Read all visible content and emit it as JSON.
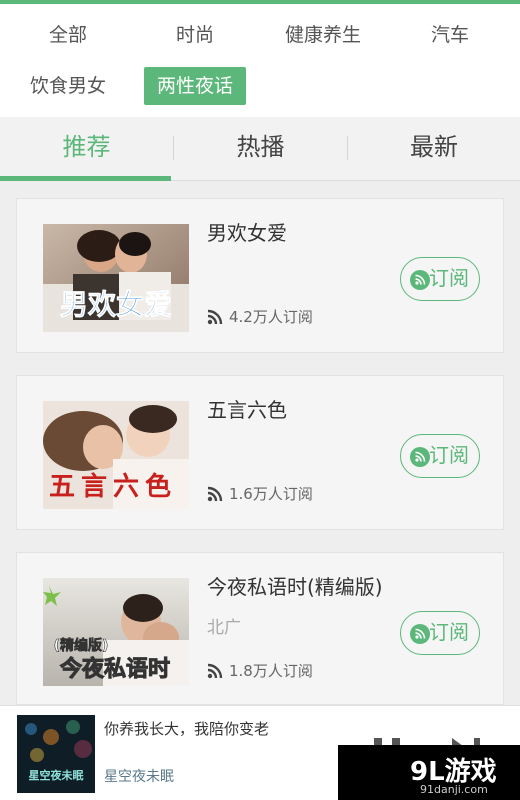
{
  "categories": {
    "items": [
      "全部",
      "时尚",
      "健康养生",
      "汽车",
      "饮食男女",
      "两性夜话"
    ],
    "active_index": 5
  },
  "tabs": {
    "items": [
      "推荐",
      "热播",
      "最新"
    ],
    "active_index": 0
  },
  "programs": [
    {
      "title": "男欢女爱",
      "subtitle": "",
      "subscribers": "4.2万人订阅",
      "subscribe_label": "订阅",
      "cover_text": "男欢女爱"
    },
    {
      "title": "五言六色",
      "subtitle": "",
      "subscribers": "1.6万人订阅",
      "subscribe_label": "订阅",
      "cover_text": "五言六色"
    },
    {
      "title": "今夜私语时(精编版)",
      "subtitle": "北广",
      "subscribers": "1.8万人订阅",
      "subscribe_label": "订阅",
      "cover_text_top": "(精编版)",
      "cover_text": "今夜私语时"
    }
  ],
  "player": {
    "title": "你养我长大，我陪你变老",
    "subtitle": "星空夜未眠",
    "cover_text": "星空夜未眠"
  },
  "watermark": {
    "logo": "9L游戏",
    "url": "91danji.com"
  },
  "colors": {
    "accent": "#5cb87a",
    "background": "#eeeeee",
    "card": "#f5f5f5"
  },
  "icons": {
    "subscribe": "rss-circle-icon",
    "subscribers": "rss-icon",
    "pause": "pause-icon",
    "next": "next-icon"
  }
}
